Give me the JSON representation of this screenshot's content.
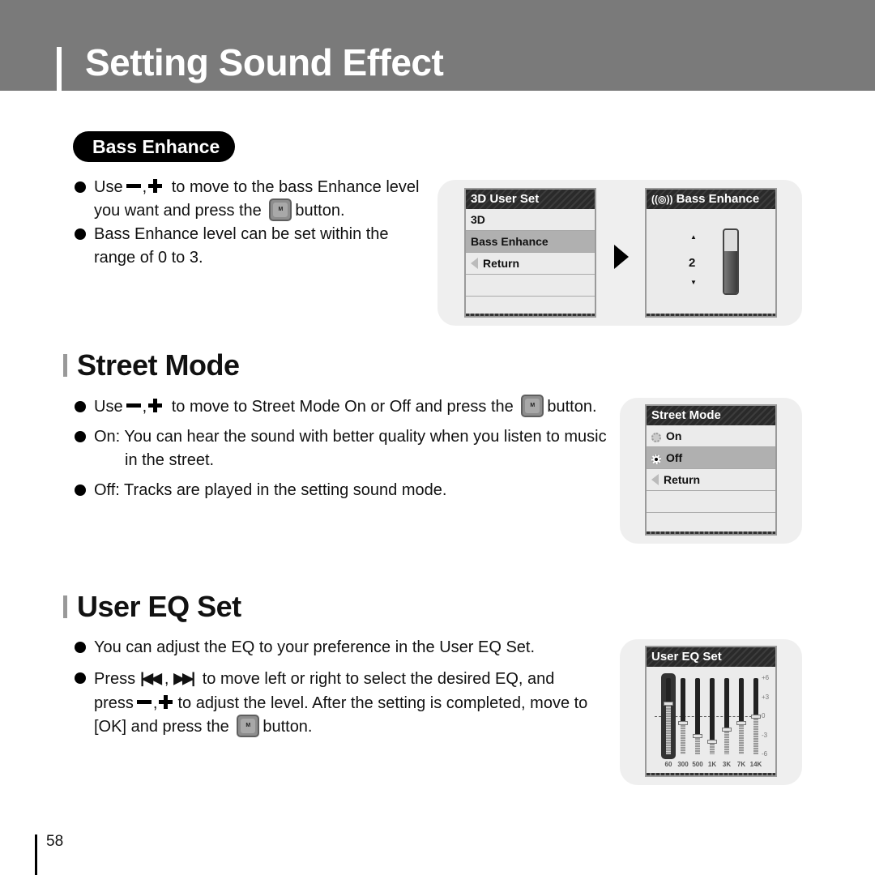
{
  "header": {
    "title": "Setting Sound Effect"
  },
  "bass_enhance": {
    "pill_label": "Bass Enhance",
    "bullets": [
      {
        "pre": "Use",
        "mid": "to move to the bass Enhance level",
        "line2_pre": "you want and press the",
        "line2_post": "button."
      },
      {
        "text1": "Bass Enhance level can be set within the",
        "text2": "range of 0 to 3."
      }
    ],
    "menu_screen": {
      "title": "3D User Set",
      "items": [
        "3D",
        "Bass Enhance",
        "Return"
      ],
      "selected_index": 1
    },
    "level_screen": {
      "title": "Bass Enhance",
      "value": "2",
      "level": 2,
      "range": [
        0,
        3
      ]
    }
  },
  "street_mode": {
    "heading": "Street Mode",
    "bullets": [
      {
        "pre": "Use",
        "mid": "to move to Street Mode On or Off and press the",
        "post": "button."
      },
      {
        "text1": "On: You can hear the sound with better quality when you listen to music",
        "text2": "in the street."
      },
      {
        "text1": "Off: Tracks are played in the setting sound mode."
      }
    ],
    "screen": {
      "title": "Street Mode",
      "options": [
        "On",
        "Off"
      ],
      "selected": "Off",
      "return_label": "Return"
    }
  },
  "user_eq": {
    "heading": "User EQ Set",
    "bullets": [
      {
        "text1": "You can adjust the EQ to your preference in the User EQ Set."
      },
      {
        "pre": "Press",
        "mid": "to move left or right to select the desired EQ, and",
        "line2_pre": "press",
        "line2_mid": "to adjust the level. After the setting is completed, move to",
        "line3_pre": "[OK] and press the",
        "line3_post": "button."
      }
    ],
    "screen": {
      "title": "User EQ Set",
      "bands": [
        "60",
        "300",
        "500",
        "1K",
        "3K",
        "7K",
        "14K"
      ],
      "levels": [
        2,
        -1,
        -3,
        -4,
        -2,
        -1,
        0
      ],
      "selected_band": "60",
      "scale": [
        "+6",
        "+3",
        "0",
        "-3",
        "-6"
      ]
    }
  },
  "button_label": "M",
  "page_number": "58"
}
